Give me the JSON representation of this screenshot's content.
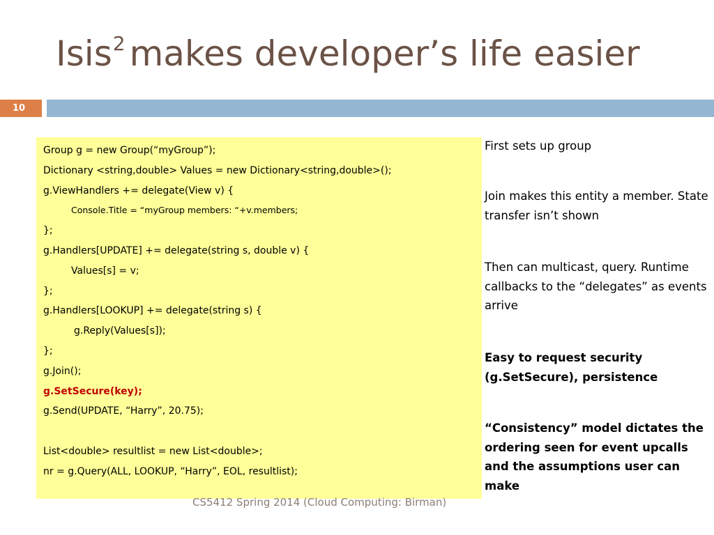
{
  "slide": {
    "title_main": "Isis",
    "title_sup": "2",
    "title_rest": "makes developer’s life easier",
    "number": "10",
    "footer": "CS5412 Spring 2014 (Cloud Computing: Birman)"
  },
  "code_lines": [
    "Group g = new Group(“myGroup”);",
    "Dictionary <string,double> Values = new Dictionary<string,double>();",
    "g.ViewHandlers += delegate(View v) {",
    "Console.Title = “myGroup members: “+v.members;",
    "};",
    "g.Handlers[UPDATE] += delegate(string s, double v) {",
    "Values[s] = v;",
    "};",
    "g.Handlers[LOOKUP] += delegate(string s) {",
    "g.Reply(Values[s]);",
    "};",
    "g.Join();",
    "g.SetSecure(key);",
    "g.Send(UPDATE, “Harry”, 20.75);",
    "",
    "List<double> resultlist = new List<double>;",
    "nr = g.Query(ALL, LOOKUP, “Harry”, EOL, resultlist);"
  ],
  "notes": [
    "First sets up group",
    "Join makes this entity a member. State transfer isn’t shown",
    "Then can multicast, query.  Runtime callbacks to the “delegates” as events arrive",
    "Easy to request security (g.SetSecure), persistence",
    "“Consistency” model dictates the ordering seen for event upcalls and the assumptions user can make"
  ],
  "colors": {
    "title": "#6b5246",
    "accent_orange": "#dd8047",
    "accent_blue": "#94b6d2",
    "code_background": "#ffff99",
    "code_highlight_red": "#c00000"
  }
}
